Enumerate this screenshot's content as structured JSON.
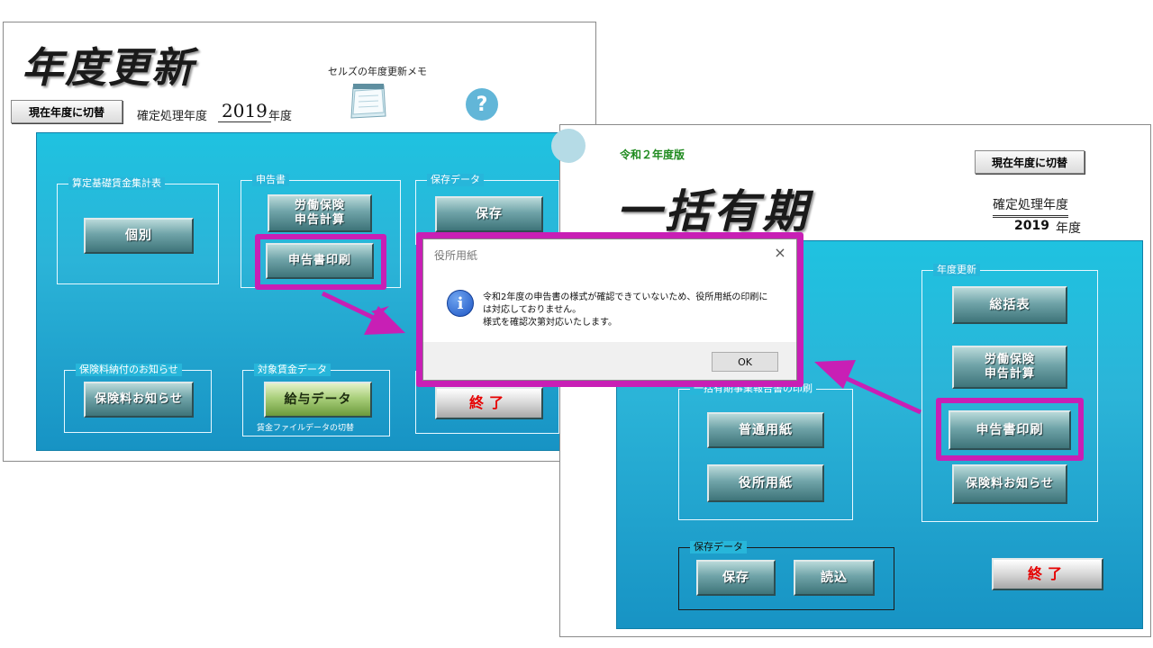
{
  "left": {
    "title": "年度更新",
    "switch_button": "現在年度に切替",
    "fiscal_label": "確定処理年度",
    "fiscal_year": "2019",
    "year_suffix": "年度",
    "memo_label": "セルズの年度更新メモ",
    "help_glyph": "?",
    "groups": {
      "santei": "算定基礎賃金集計表",
      "shinkoku": "申告書",
      "hozon": "保存データ",
      "hokenryo": "保険料納付のお知らせ",
      "chingin": "対象賃金データ"
    },
    "buttons": {
      "kobetsu": "個別",
      "roudou": "労働保険\n申告計算",
      "shinkoku_print": "申告書印刷",
      "hozon": "保存",
      "oshirase": "保険料お知らせ",
      "kyuyo": "給与データ",
      "end": "終了"
    },
    "chingin_note": "賃金ファイルデータの切替"
  },
  "right": {
    "edition": "令和２年度版",
    "title": "一括有期",
    "switch_button": "現在年度に切替",
    "fiscal_label": "確定処理年度",
    "fiscal_year": "2019",
    "year_suffix": "年度",
    "groups": {
      "ikkatsu": "一括有期事業報告書の印刷",
      "nendo": "年度更新",
      "hozon": "保存データ"
    },
    "buttons": {
      "futsu": "普通用紙",
      "yakusho": "役所用紙",
      "soukatsu": "総括表",
      "roudou": "労働保険\n申告計算",
      "shinkoku_print": "申告書印刷",
      "oshirase": "保険料お知らせ",
      "hozon": "保存",
      "yomikomi": "読込",
      "end": "終了"
    }
  },
  "dialog": {
    "title": "役所用紙",
    "close_glyph": "×",
    "icon_glyph": "i",
    "message_line1": "令和2年度の申告書の様式が確認できていないため、役所用紙の印刷に",
    "message_line2": "は対応しておりません。",
    "message_line3": "様式を確認次第対応いたします。",
    "ok_label": "OK"
  },
  "colors": {
    "highlight": "#c81fb5",
    "panel": "#27b6da",
    "end_text": "#e60000"
  }
}
